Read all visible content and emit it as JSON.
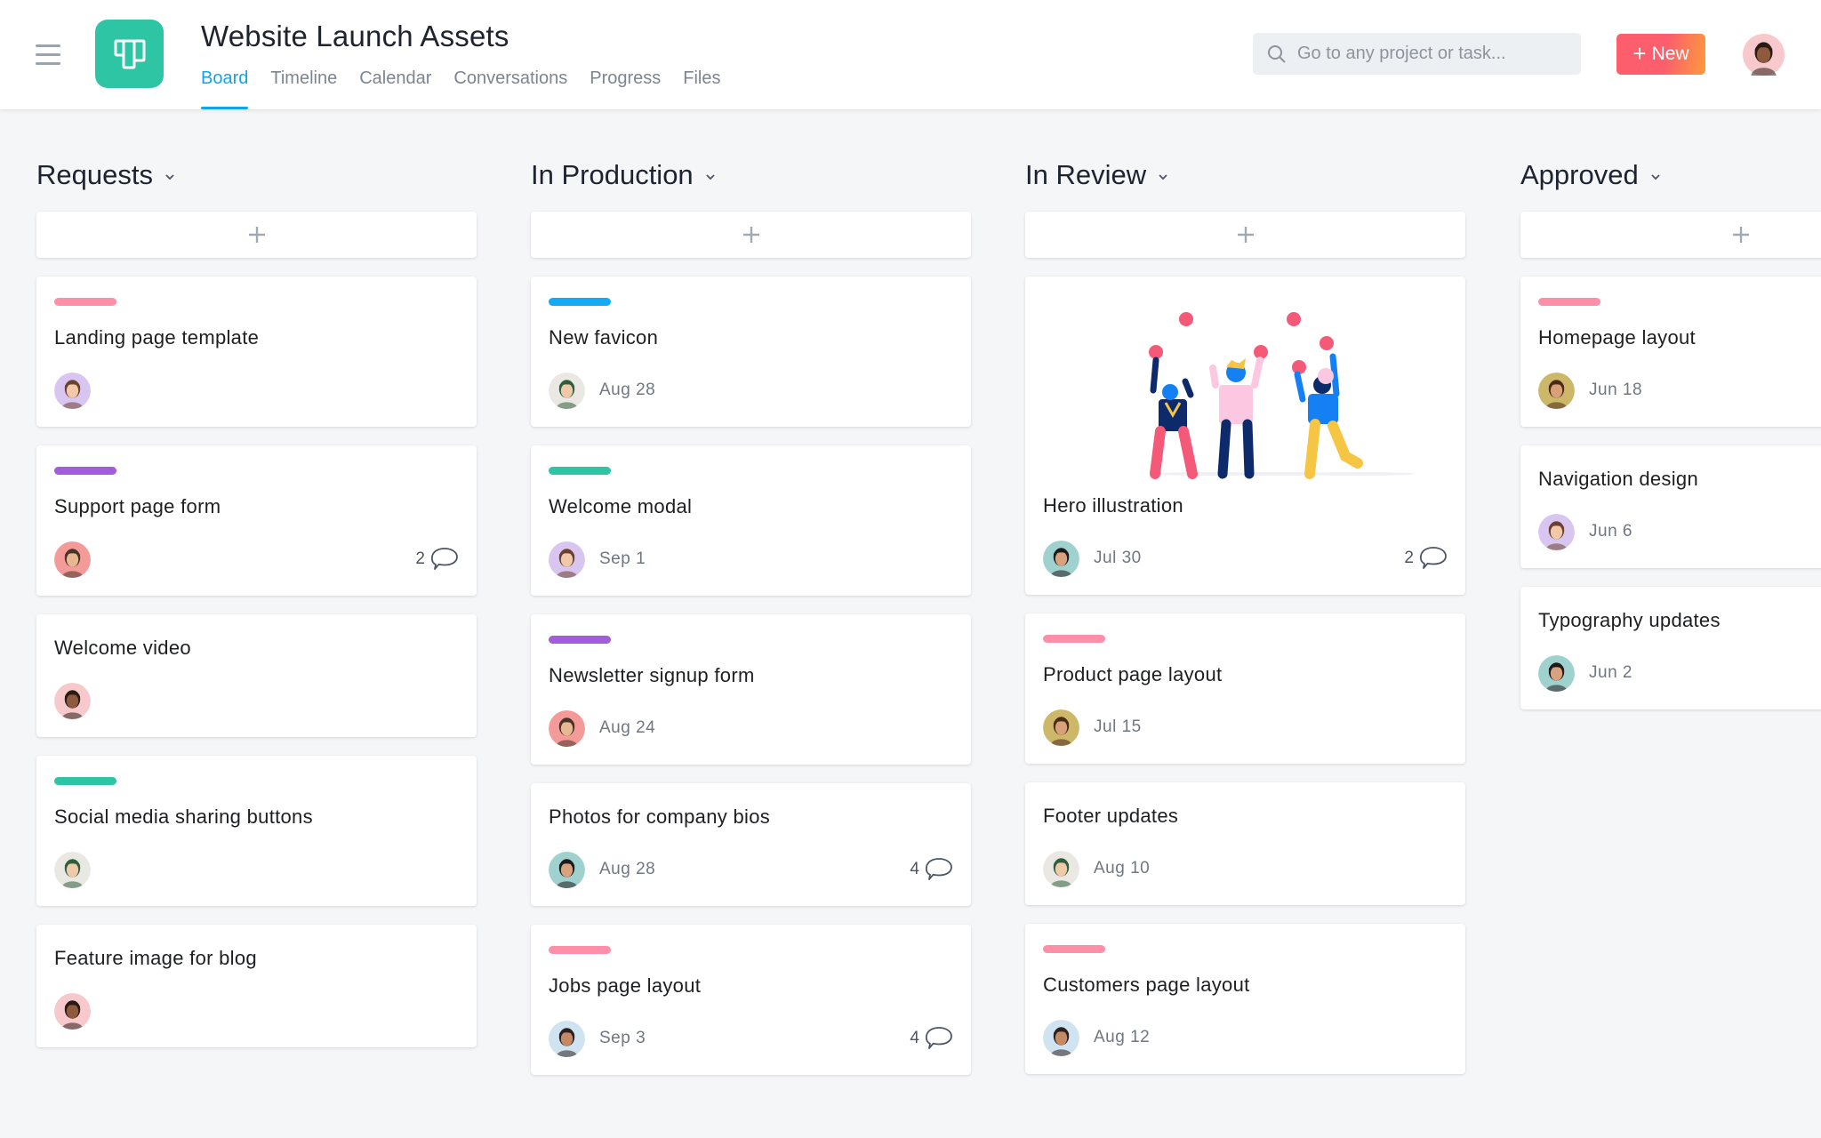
{
  "header": {
    "project_title": "Website Launch Assets",
    "tabs": [
      {
        "label": "Board",
        "active": true
      },
      {
        "label": "Timeline",
        "active": false
      },
      {
        "label": "Calendar",
        "active": false
      },
      {
        "label": "Conversations",
        "active": false
      },
      {
        "label": "Progress",
        "active": false
      },
      {
        "label": "Files",
        "active": false
      }
    ],
    "search_placeholder": "Go to any project or task...",
    "new_button_label": "New",
    "app_icon_color": "#2ec5a5",
    "accent_color": "#14a3e8"
  },
  "tag_colors": {
    "pink": "#fd8fa8",
    "blue": "#14aaf5",
    "teal": "#2ec5a5",
    "purple": "#a25ddc"
  },
  "columns": [
    {
      "title": "Requests",
      "cards": [
        {
          "tag": "pink",
          "title": "Landing page template",
          "avatar": "woman-bangs-lavender",
          "due": "",
          "comments": ""
        },
        {
          "tag": "purple",
          "title": "Support page form",
          "avatar": "man-coral",
          "due": "",
          "comments": "2"
        },
        {
          "tag": "",
          "title": "Welcome video",
          "avatar": "woman-pink",
          "due": "",
          "comments": ""
        },
        {
          "tag": "teal",
          "title": "Social media sharing buttons",
          "avatar": "man-cap-gray",
          "due": "",
          "comments": ""
        },
        {
          "tag": "",
          "title": "Feature image for blog",
          "avatar": "woman-pink",
          "due": "",
          "comments": ""
        }
      ]
    },
    {
      "title": "In Production",
      "cards": [
        {
          "tag": "blue",
          "title": "New favicon",
          "avatar": "man-cap-gray",
          "due": "Aug 28",
          "comments": ""
        },
        {
          "tag": "teal",
          "title": "Welcome modal",
          "avatar": "woman-bangs-lavender",
          "due": "Sep 1",
          "comments": ""
        },
        {
          "tag": "purple",
          "title": "Newsletter signup form",
          "avatar": "man-coral",
          "due": "Aug 24",
          "comments": ""
        },
        {
          "tag": "",
          "title": "Photos for company bios",
          "avatar": "person-teal",
          "due": "Aug 28",
          "comments": "4"
        },
        {
          "tag": "pink",
          "title": "Jobs page layout",
          "avatar": "man-glasses-blue",
          "due": "Sep 3",
          "comments": "4"
        }
      ]
    },
    {
      "title": "In Review",
      "cards": [
        {
          "tag": "",
          "illustration": true,
          "title": "Hero illustration",
          "avatar": "person-teal",
          "due": "Jul 30",
          "comments": "2"
        },
        {
          "tag": "pink",
          "title": "Product page layout",
          "avatar": "woman-gold",
          "due": "Jul 15",
          "comments": ""
        },
        {
          "tag": "",
          "title": "Footer updates",
          "avatar": "man-cap-gray",
          "due": "Aug 10",
          "comments": ""
        },
        {
          "tag": "pink",
          "title": "Customers page layout",
          "avatar": "man-glasses-blue",
          "due": "Aug 12",
          "comments": ""
        }
      ]
    },
    {
      "title": "Approved",
      "cards": [
        {
          "tag": "pink",
          "title": "Homepage layout",
          "avatar": "woman-gold",
          "due": "Jun 18",
          "comments": ""
        },
        {
          "tag": "",
          "title": "Navigation design",
          "avatar": "woman-bangs-lavender",
          "due": "Jun 6",
          "comments": ""
        },
        {
          "tag": "",
          "title": "Typography updates",
          "avatar": "person-teal",
          "due": "Jun 2",
          "comments": ""
        }
      ]
    }
  ],
  "avatar_styles": {
    "woman-bangs-lavender": {
      "bg": "#d9c6f0",
      "hair": "#6b4030",
      "skin": "#f2c9a8"
    },
    "man-coral": {
      "bg": "#f49a98",
      "hair": "#4a3426",
      "skin": "#e8b894"
    },
    "woman-pink": {
      "bg": "#f8c9cc",
      "hair": "#2a1a14",
      "skin": "#8d5a3d"
    },
    "man-cap-gray": {
      "bg": "#e9e8e3",
      "hair": "#2f5e3d",
      "skin": "#f0c9a8"
    },
    "person-teal": {
      "bg": "#9fd1cf",
      "hair": "#1c1a1a",
      "skin": "#d9a27f"
    },
    "man-glasses-blue": {
      "bg": "#cfe3f0",
      "hair": "#2a2020",
      "skin": "#c58a64"
    },
    "woman-gold": {
      "bg": "#cdb86a",
      "hair": "#4b2a18",
      "skin": "#d9a07a"
    },
    "user-header": {
      "bg": "#f8c9cc",
      "hair": "#2a1a14",
      "skin": "#8d5a3d"
    }
  }
}
